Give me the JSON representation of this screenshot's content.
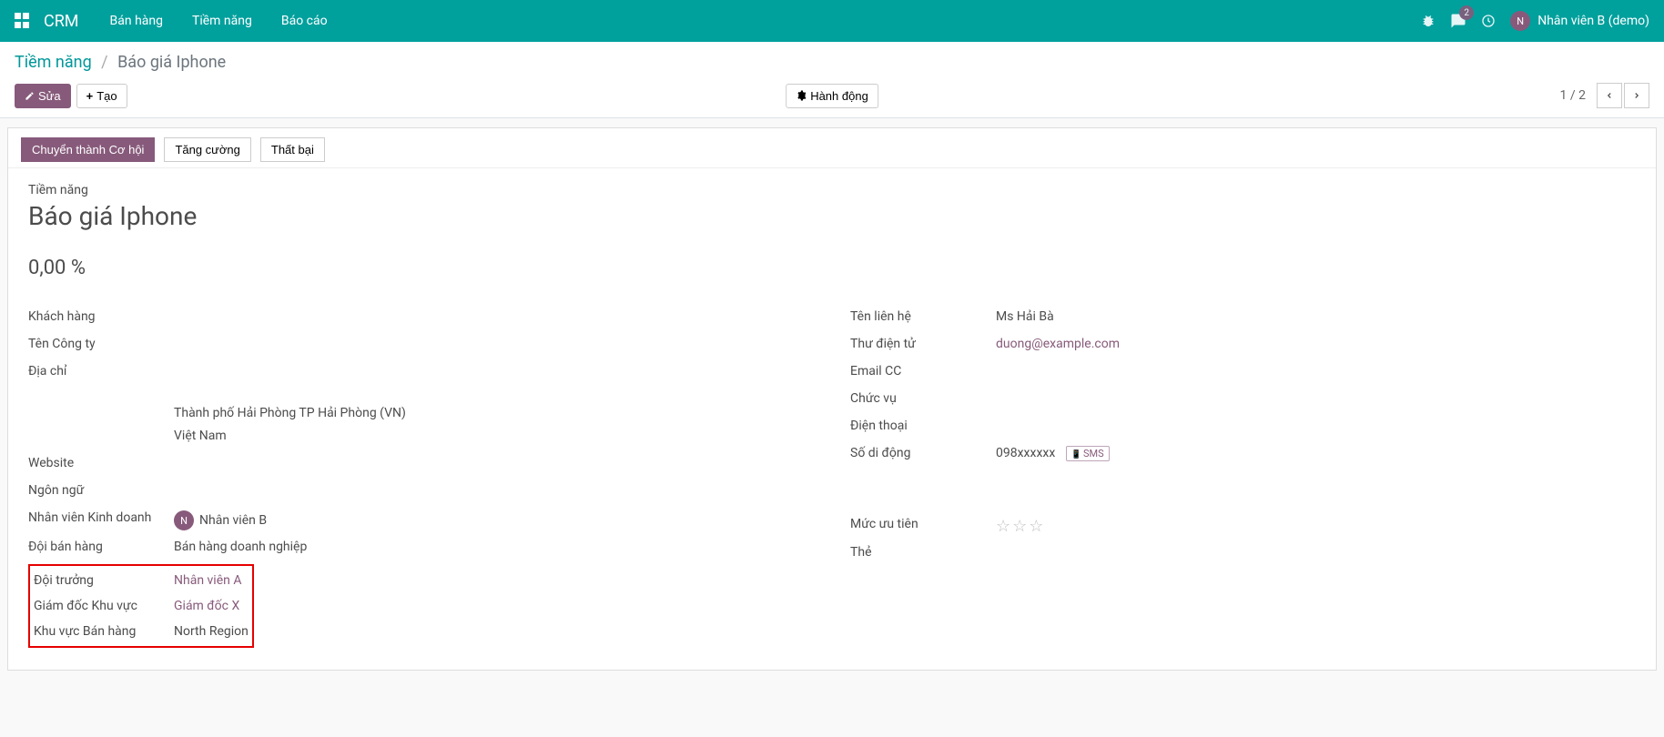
{
  "topbar": {
    "app_title": "CRM",
    "nav": [
      "Bán hàng",
      "Tiềm năng",
      "Báo cáo"
    ],
    "chat_badge": "2",
    "user_initial": "N",
    "user_name": "Nhân viên B (demo)"
  },
  "breadcrumb": {
    "parent": "Tiềm năng",
    "current": "Báo giá Iphone"
  },
  "toolbar": {
    "edit": "Sửa",
    "create": "Tạo",
    "action": "Hành động",
    "pager": "1 / 2"
  },
  "status": {
    "convert": "Chuyển thành Cơ hội",
    "enrich": "Tăng cường",
    "lost": "Thất bại"
  },
  "form": {
    "lead_label": "Tiềm năng",
    "lead_title": "Báo giá Iphone",
    "percent": "0,00 %"
  },
  "left_labels": {
    "customer": "Khách hàng",
    "company": "Tên Công ty",
    "address": "Địa chỉ",
    "website": "Website",
    "language": "Ngôn ngữ",
    "salesperson": "Nhân viên Kinh doanh",
    "salesteam": "Đội bán hàng",
    "team_leader": "Đội trưởng",
    "regional_manager": "Giám đốc Khu vực",
    "sales_region": "Khu vực Bán hàng"
  },
  "left_values": {
    "address_line1": "Thành phố Hải Phòng    TP Hải Phòng (VN)",
    "address_line2": "Việt Nam",
    "salesperson_initial": "N",
    "salesperson": "Nhân viên B",
    "salesteam": "Bán hàng doanh nghiệp",
    "team_leader": "Nhân viên A",
    "regional_manager": "Giám đốc X",
    "sales_region": "North Region"
  },
  "right_labels": {
    "contact": "Tên liên hệ",
    "email": "Thư điện tử",
    "emailcc": "Email CC",
    "job": "Chức vụ",
    "phone": "Điện thoại",
    "mobile": "Số di động",
    "priority": "Mức ưu tiên",
    "tags": "Thẻ"
  },
  "right_values": {
    "contact": "Ms Hải Bà",
    "email": "duong@example.com",
    "mobile": "098xxxxxx",
    "sms": "SMS"
  }
}
